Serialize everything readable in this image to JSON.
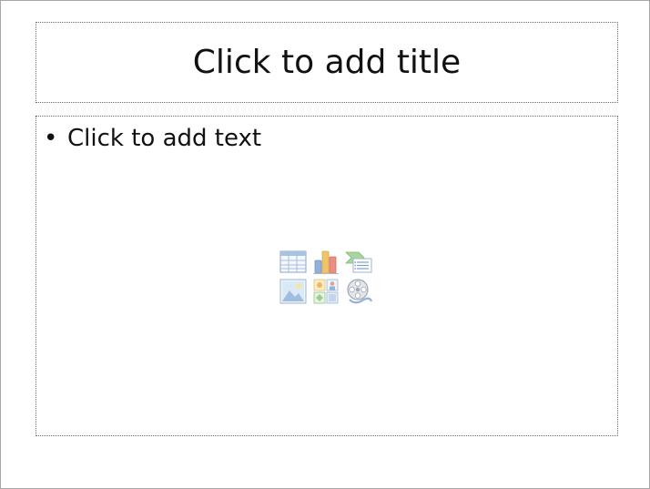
{
  "slide": {
    "title_placeholder": "Click to add title",
    "body_bullet": "•",
    "body_placeholder": "Click to add text"
  },
  "insert_icons": [
    {
      "name": "insert-table-icon"
    },
    {
      "name": "insert-chart-icon"
    },
    {
      "name": "insert-smartart-icon"
    },
    {
      "name": "insert-picture-icon"
    },
    {
      "name": "insert-clipart-icon"
    },
    {
      "name": "insert-media-icon"
    }
  ],
  "colors": {
    "border": "#a7a7a7",
    "placeholder_border": "#6b6b6b",
    "text": "#111111",
    "icon_blue": "#7f9fc8",
    "icon_green": "#9ccc90",
    "icon_red": "#e8857a"
  }
}
